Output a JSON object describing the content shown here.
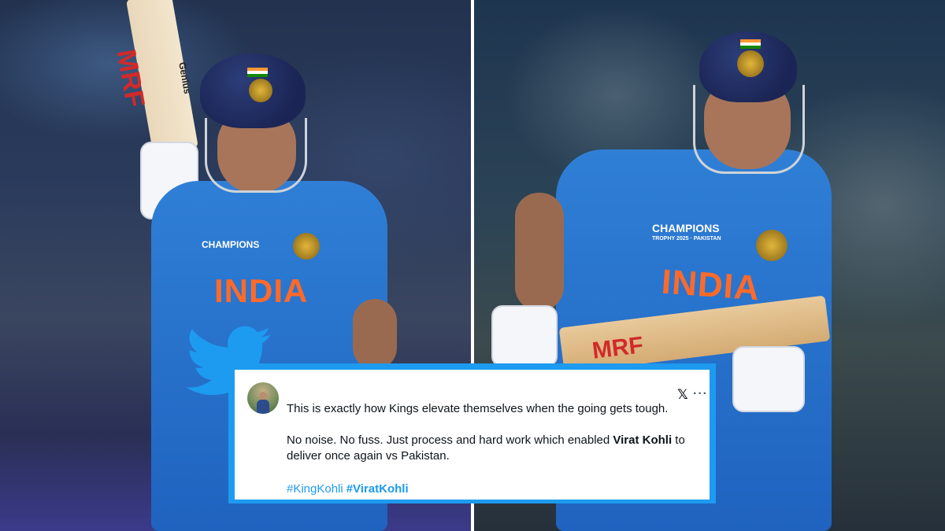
{
  "images": {
    "left": {
      "shirt_text": "INDIA",
      "tournament_text": "CHAMPIONS",
      "bat_brand": "MRF",
      "bat_model": "Genius"
    },
    "right": {
      "shirt_text": "INDIA",
      "tournament_text": "CHAMPIONS",
      "tournament_sub": "TROPHY 2025 · PAKISTAN",
      "bat_brand": "MRF"
    }
  },
  "tweet": {
    "line1": "This is exactly how Kings elevate themselves when the going gets tough.",
    "line2_pre": "No noise. No fuss. Just process and hard work which enabled ",
    "line2_bold": "Virat Kohli",
    "line2_post": " to",
    "line3": "deliver once again vs Pakistan.",
    "hashtags": [
      "#KingKohli",
      "#ViratKohli"
    ],
    "x_logo": "𝕏",
    "more": "···"
  },
  "colors": {
    "twitter_blue": "#1d9bf0",
    "text": "#0f1419",
    "shirt_blue": "#2f7fd6",
    "shirt_text_orange": "#ff6a2a"
  },
  "icons": [
    "twitter-bird-icon",
    "x-logo-icon",
    "more-options-icon"
  ]
}
